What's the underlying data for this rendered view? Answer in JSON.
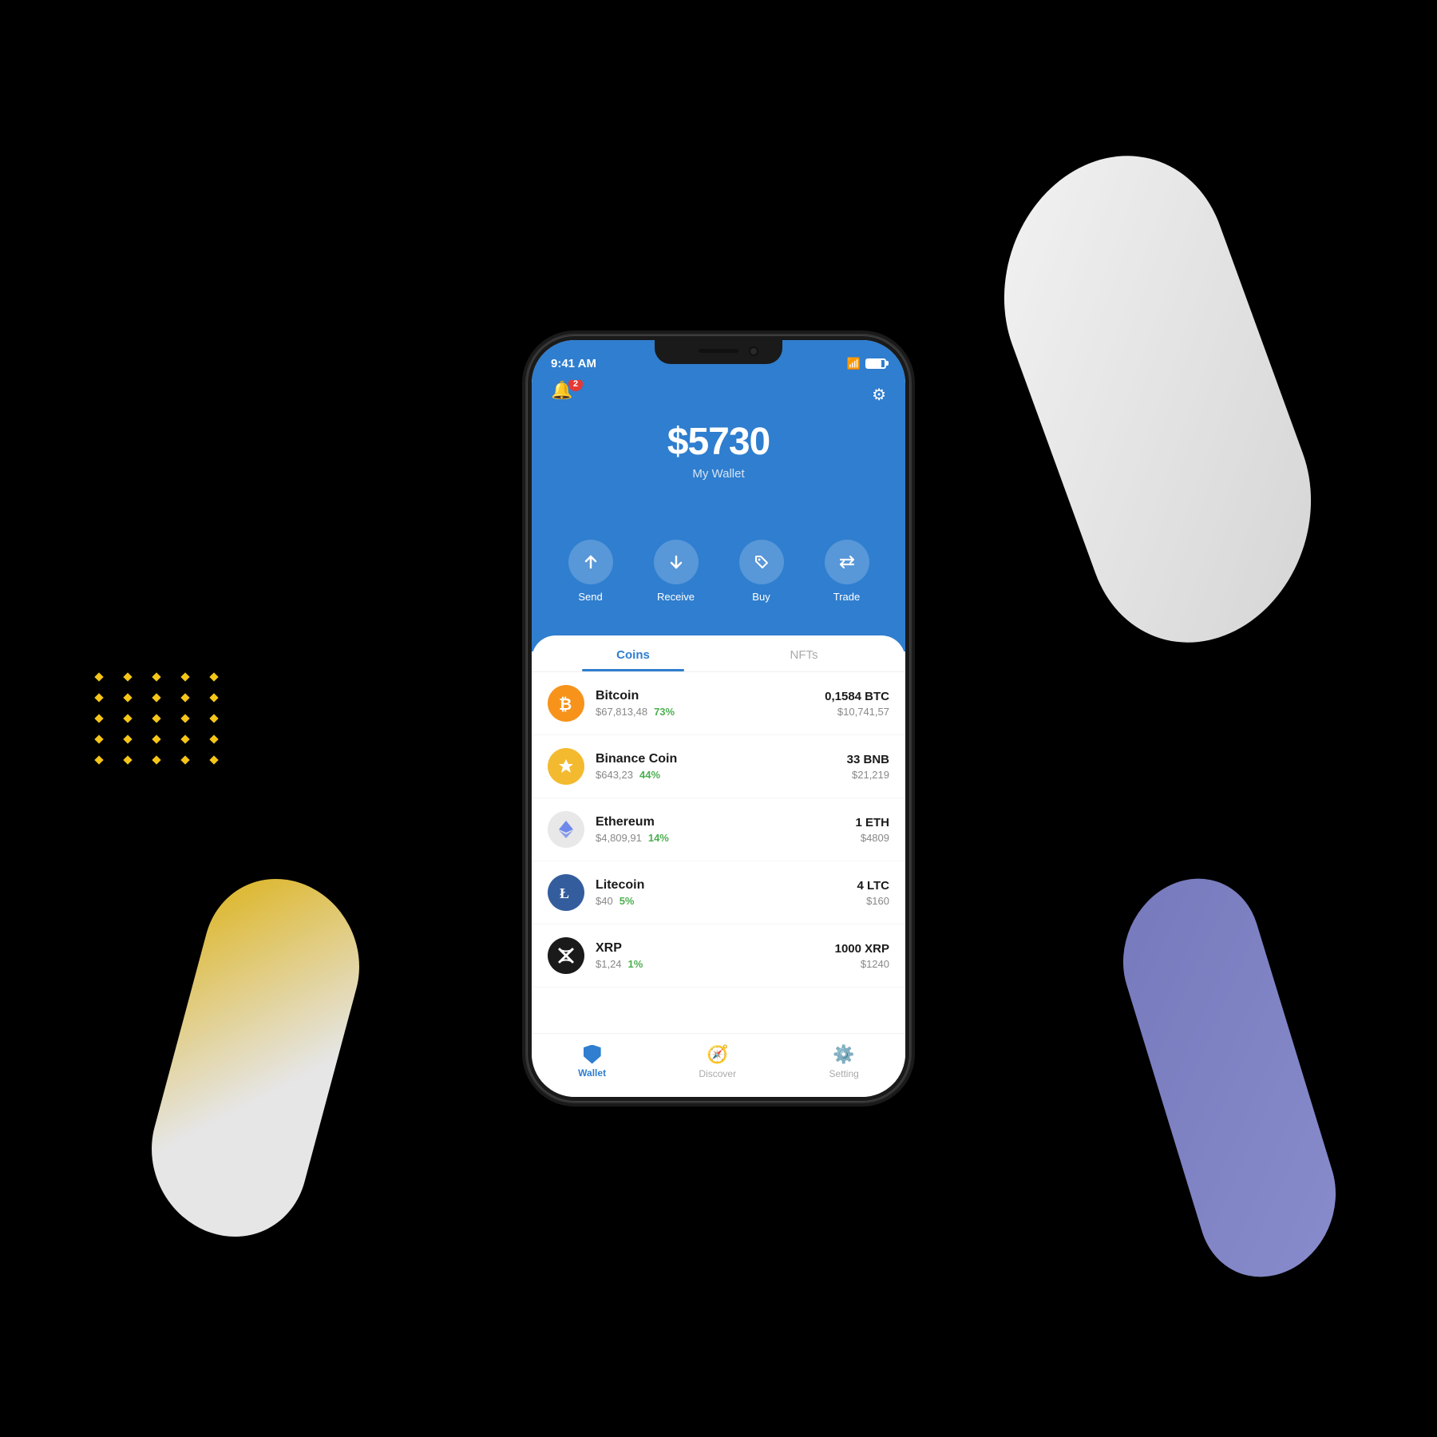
{
  "background": "#000000",
  "status_bar": {
    "time": "9:41 AM",
    "wifi": "wifi",
    "battery": "battery"
  },
  "header": {
    "notification_count": "2",
    "wallet_amount": "$5730",
    "wallet_label": "My Wallet"
  },
  "actions": [
    {
      "id": "send",
      "label": "Send",
      "icon": "↑"
    },
    {
      "id": "receive",
      "label": "Receive",
      "icon": "↓"
    },
    {
      "id": "buy",
      "label": "Buy",
      "icon": "🏷"
    },
    {
      "id": "trade",
      "label": "Trade",
      "icon": "⇄"
    }
  ],
  "tabs": [
    {
      "id": "coins",
      "label": "Coins",
      "active": true
    },
    {
      "id": "nfts",
      "label": "NFTs",
      "active": false
    }
  ],
  "coins": [
    {
      "id": "btc",
      "name": "Bitcoin",
      "price": "$67,813,48",
      "pct": "73%",
      "amount": "0,1584 BTC",
      "value": "$10,741,57",
      "color_class": "btc",
      "symbol": "₿"
    },
    {
      "id": "bnb",
      "name": "Binance Coin",
      "price": "$643,23",
      "pct": "44%",
      "amount": "33 BNB",
      "value": "$21,219",
      "color_class": "bnb",
      "symbol": "◆"
    },
    {
      "id": "eth",
      "name": "Ethereum",
      "price": "$4,809,91",
      "pct": "14%",
      "amount": "1 ETH",
      "value": "$4809",
      "color_class": "eth",
      "symbol": "◇"
    },
    {
      "id": "ltc",
      "name": "Litecoin",
      "price": "$40",
      "pct": "5%",
      "amount": "4 LTC",
      "value": "$160",
      "color_class": "ltc",
      "symbol": "Ł"
    },
    {
      "id": "xrp",
      "name": "XRP",
      "price": "$1,24",
      "pct": "1%",
      "amount": "1000 XRP",
      "value": "$1240",
      "color_class": "xrp",
      "symbol": "✕"
    }
  ],
  "bottom_nav": [
    {
      "id": "wallet",
      "label": "Wallet",
      "active": true
    },
    {
      "id": "discover",
      "label": "Discover",
      "active": false
    },
    {
      "id": "setting",
      "label": "Setting",
      "active": false
    }
  ]
}
